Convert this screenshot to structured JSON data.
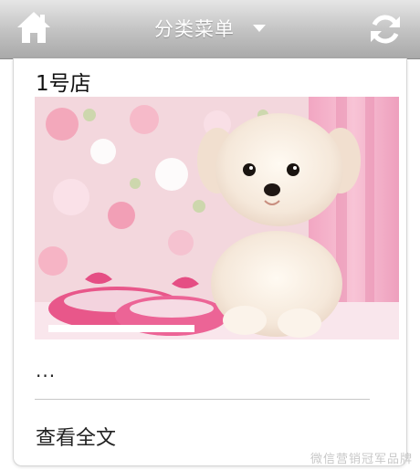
{
  "header": {
    "home_icon": "home-icon",
    "menu_label": "分类菜单",
    "menu_caret_icon": "caret-down-icon",
    "refresh_icon": "refresh-icon",
    "bar_color": "#b3b3b3"
  },
  "article": {
    "title": "1号店",
    "image_alt": "puppy-with-pink-shoes",
    "excerpt": "...",
    "read_more_label": "查看全文"
  },
  "watermark": {
    "text": "微信营销冠军品牌"
  }
}
